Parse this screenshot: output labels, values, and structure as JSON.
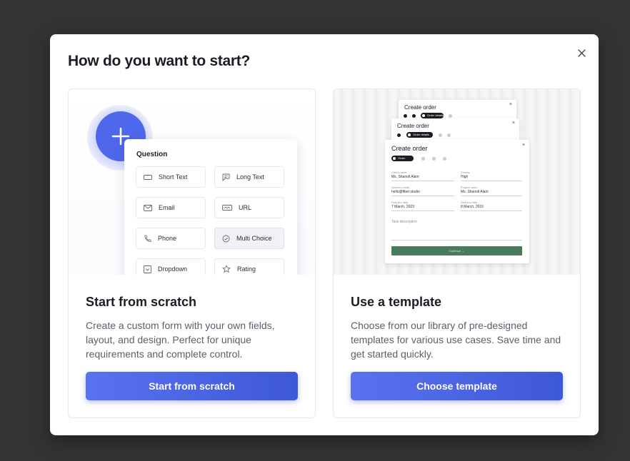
{
  "dialog": {
    "title": "How do you want to start?",
    "close_icon": "close-icon"
  },
  "scratch": {
    "title": "Start from scratch",
    "description": "Create a custom form with your own fields, layout, and design. Perfect for unique requirements and complete control.",
    "button_label": "Start from scratch",
    "illustration": {
      "panel_title": "Question",
      "items": [
        {
          "label": "Short Text",
          "icon": "short-text-icon",
          "selected": false
        },
        {
          "label": "Long Text",
          "icon": "long-text-icon",
          "selected": false
        },
        {
          "label": "Email",
          "icon": "email-icon",
          "selected": false
        },
        {
          "label": "URL",
          "icon": "url-icon",
          "selected": false
        },
        {
          "label": "Phone",
          "icon": "phone-icon",
          "selected": false
        },
        {
          "label": "Multi Choice",
          "icon": "multi-choice-icon",
          "selected": true
        },
        {
          "label": "Dropdown",
          "icon": "dropdown-icon",
          "selected": false
        },
        {
          "label": "Rating",
          "icon": "star-icon",
          "selected": false
        }
      ]
    }
  },
  "template": {
    "title": "Use a template",
    "description": "Choose from our library of pre-designed templates for various use cases. Save time and get started quickly.",
    "button_label": "Choose template",
    "illustration": {
      "form_title": "Create order",
      "step_pills": [
        "Order details",
        "Order details",
        "Order"
      ],
      "fields": [
        {
          "label": "Client name",
          "value": "Ms. Shanoll Alam"
        },
        {
          "label": "Priority",
          "value": "High"
        },
        {
          "label": "Delivery email",
          "value": "hello@fiber.studio"
        },
        {
          "label": "Project name",
          "value": "Ms. Shanoll Alam"
        },
        {
          "label": "Delivery date",
          "value": "7 March, 2023"
        },
        {
          "label": "Delivery date",
          "value": "8 March, 2023"
        }
      ],
      "description_placeholder": "Task description",
      "submit_label": "Continue →"
    }
  },
  "colors": {
    "accent": "#4f67ea",
    "template_button": "#4a7a5c",
    "backdrop": "#333333"
  }
}
